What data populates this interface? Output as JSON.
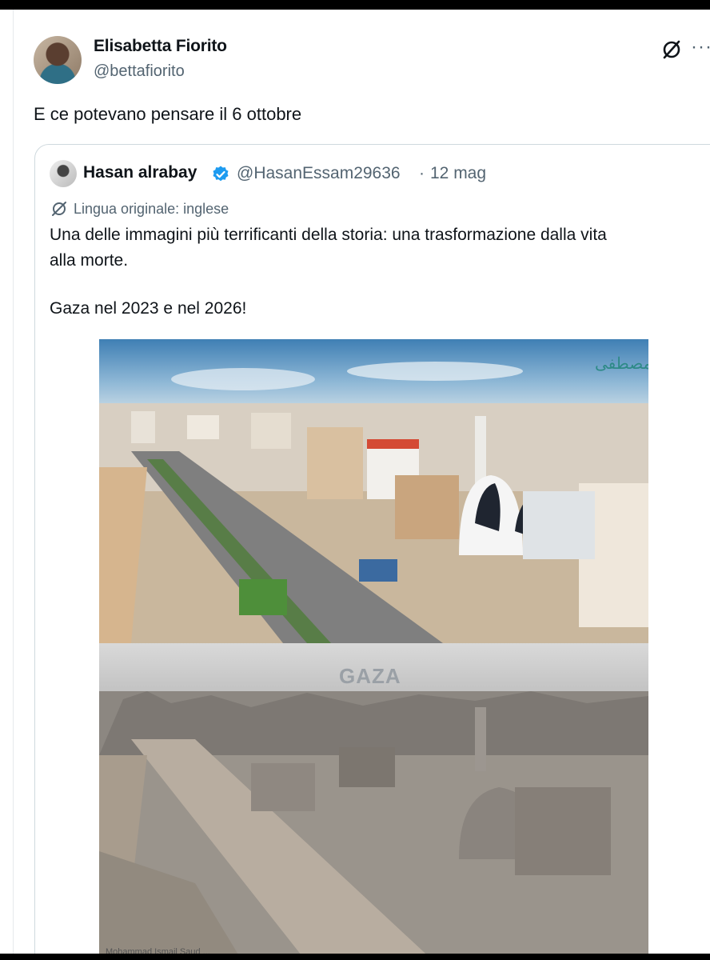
{
  "post": {
    "display_name": "Elisabetta Fiorito",
    "handle": "@bettafiorito",
    "text": "E ce potevano pensare il 6 ottobre",
    "icons": {
      "avatar": "user-avatar",
      "grok": "grok-icon",
      "more": "more-options-icon"
    },
    "more_glyph": "···"
  },
  "quote": {
    "display_name": "Hasan alrabay",
    "verified": true,
    "handle": "@HasanEssam29636",
    "separator": "·",
    "date": "12 mag",
    "translation_note": "Lingua originale: inglese",
    "lines": [
      "Una delle immagini più terrificanti della storia: una trasformazione dalla vita",
      "alla morte.",
      "Gaza nel 2023 e nel 2026!"
    ],
    "image": {
      "overlay_label": "GAZA",
      "credit": "Mohammad Ismail Saud ...",
      "watermark": "مصطفى"
    }
  },
  "colors": {
    "text_primary": "#0f1419",
    "text_secondary": "#536471",
    "border": "#cfd9de",
    "verified_blue": "#1d9bf0"
  }
}
